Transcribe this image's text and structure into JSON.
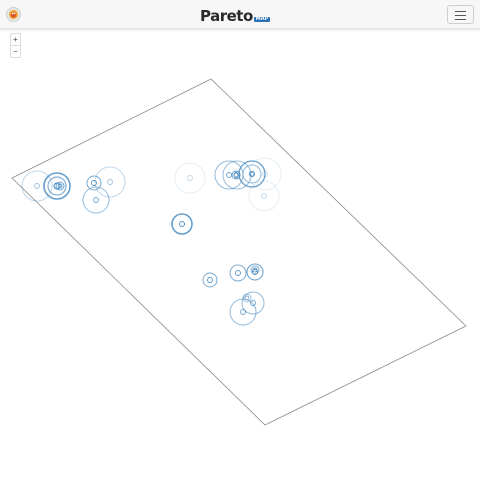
{
  "navbar": {
    "brand_name": "Pareto",
    "brand_suffix": "MAP",
    "app_icon": "app-logo-icon",
    "menu_icon": "hamburger-menu-icon"
  },
  "zoom": {
    "zoom_in": "+",
    "zoom_out": "−"
  },
  "colors": {
    "accent": "#2b6fb5",
    "marker": "#4a8cc2",
    "outline": "#8a8a8a"
  }
}
